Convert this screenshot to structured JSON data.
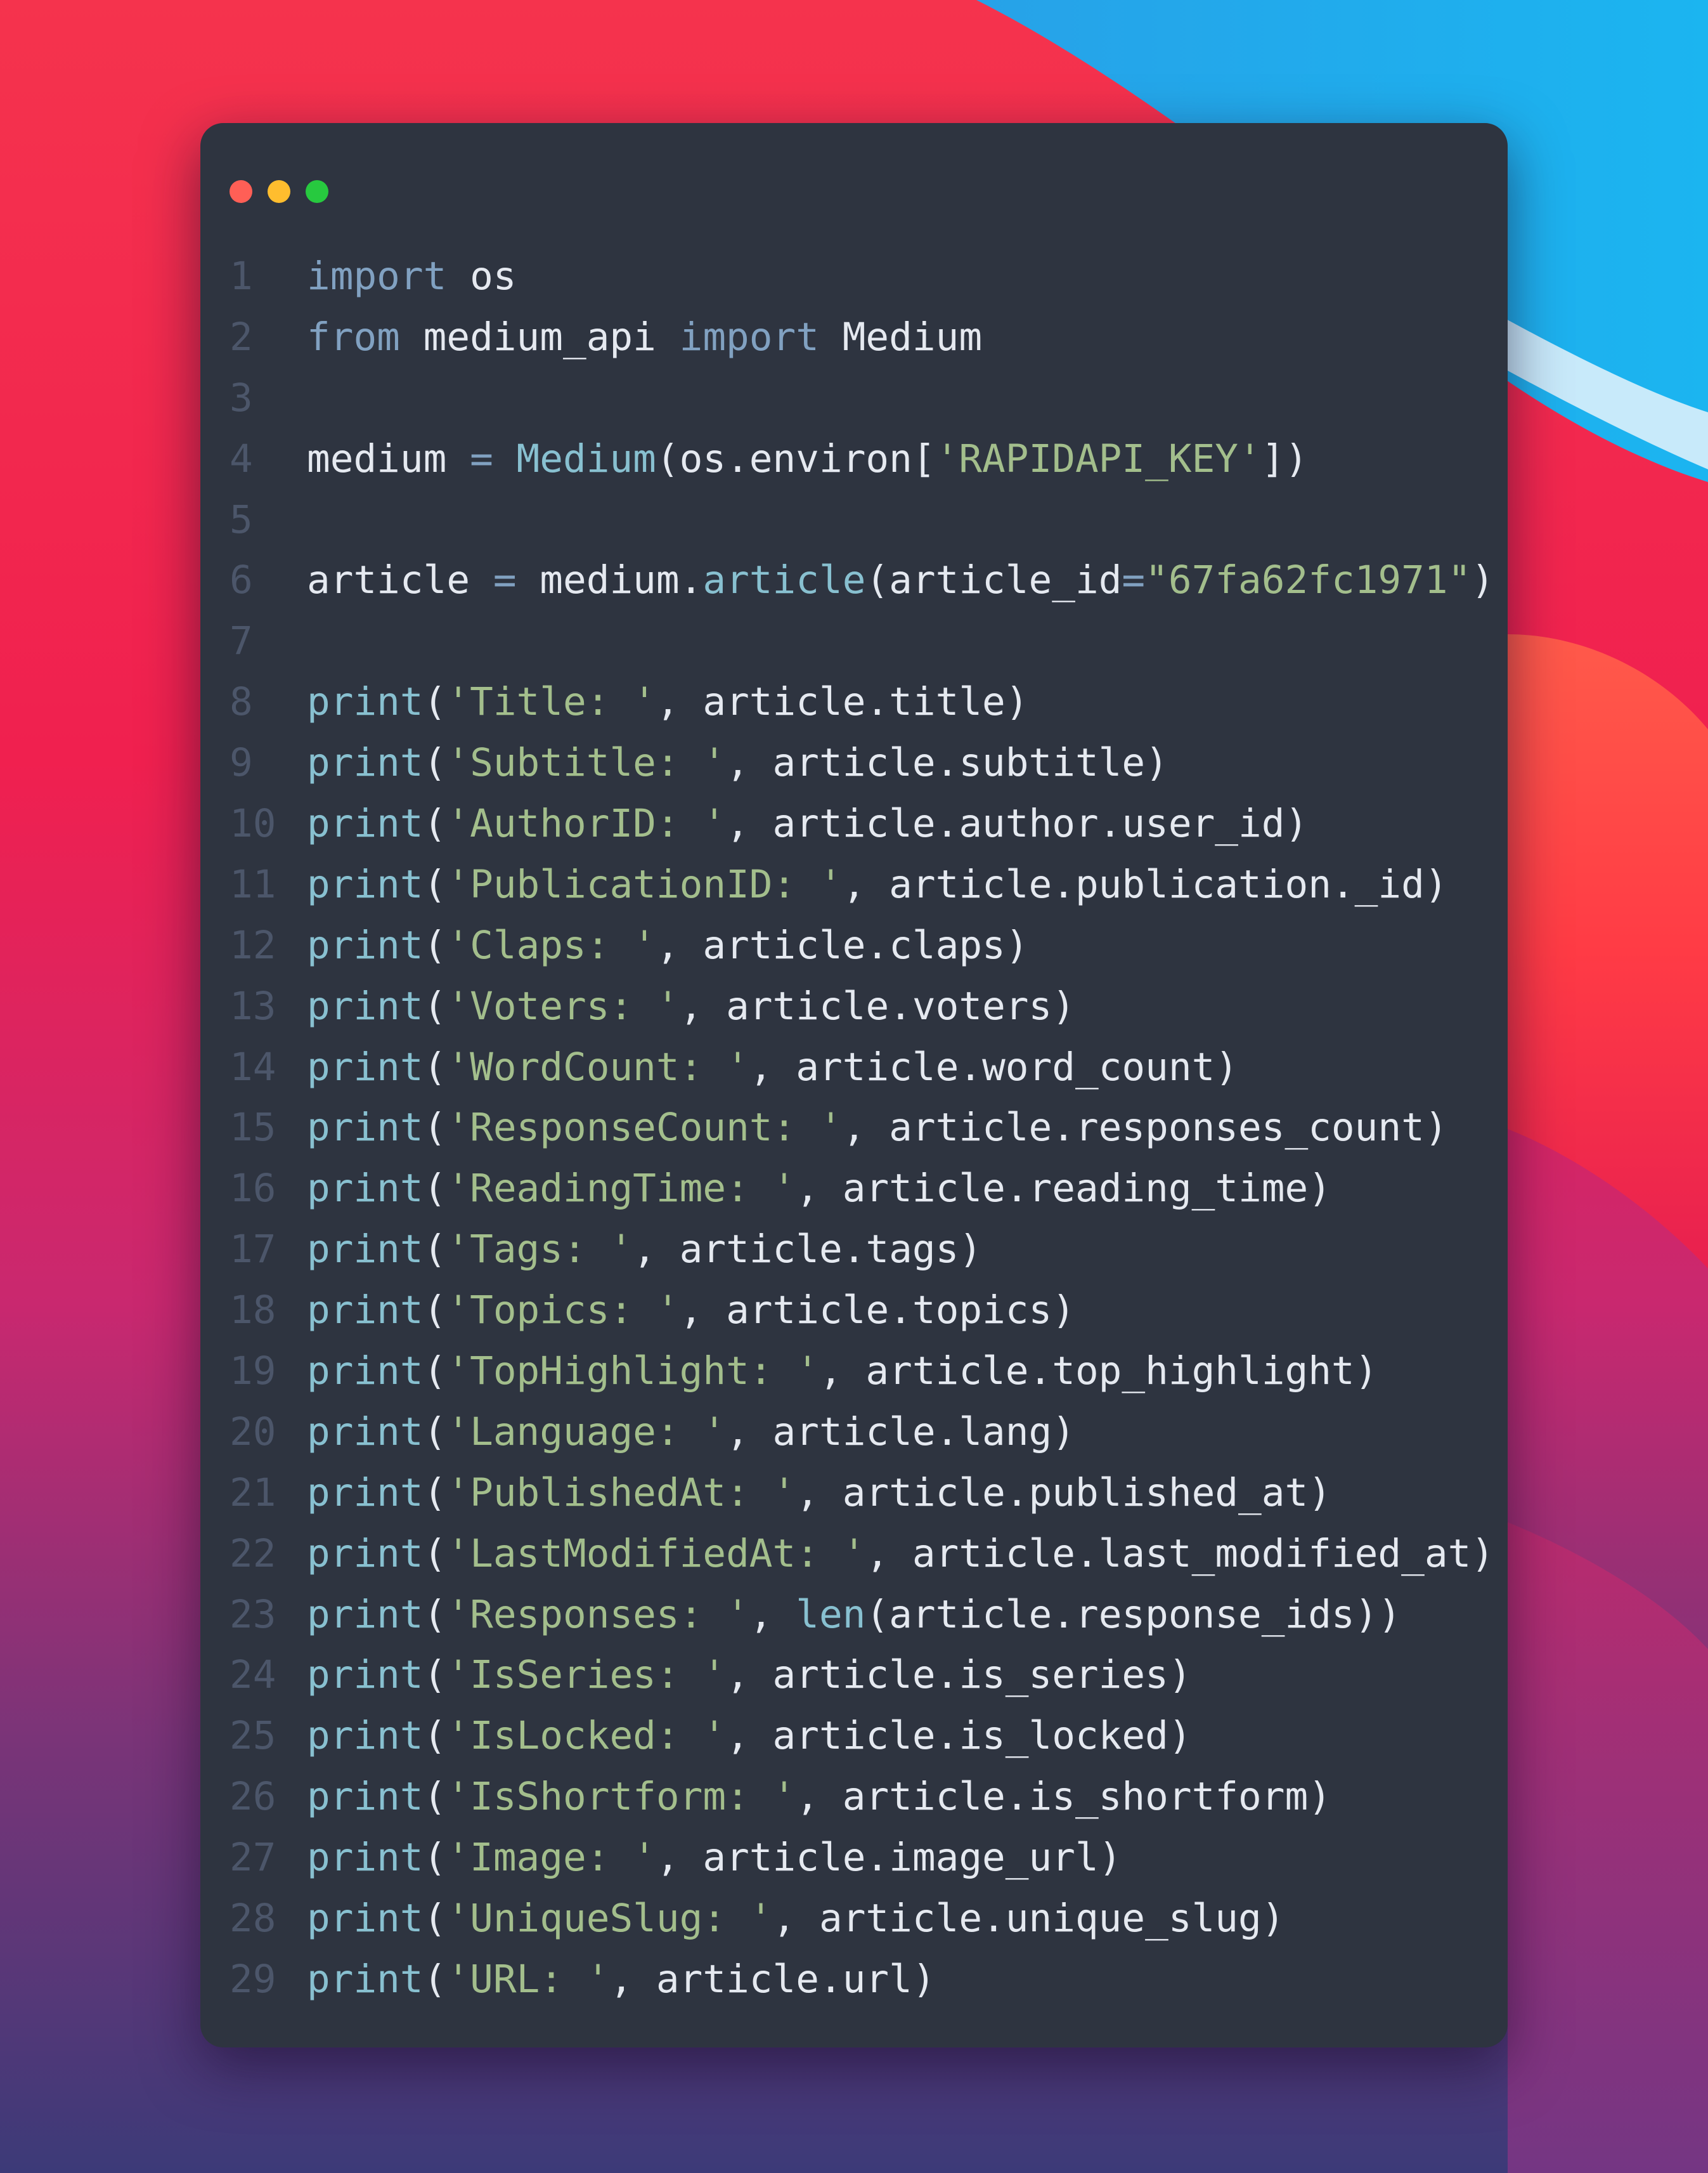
{
  "window": {
    "controls": [
      "close",
      "minimize",
      "zoom"
    ]
  },
  "theme": {
    "background": "#2e3440",
    "keyword": "#81a1c1",
    "function": "#88c0d0",
    "string": "#a3be8c",
    "text": "#e5e9f0",
    "line_number": "#4c566a",
    "close": "#ff5f56",
    "minimize": "#ffbd2e",
    "zoom": "#27c93f"
  },
  "code": {
    "language": "python",
    "lines": [
      {
        "number": "1",
        "tokens": [
          {
            "t": "kw",
            "v": "import"
          },
          {
            "t": "tx",
            "v": " os"
          }
        ]
      },
      {
        "number": "2",
        "tokens": [
          {
            "t": "kw",
            "v": "from"
          },
          {
            "t": "tx",
            "v": " medium_api "
          },
          {
            "t": "kw",
            "v": "import"
          },
          {
            "t": "tx",
            "v": " Medium"
          }
        ]
      },
      {
        "number": "3",
        "tokens": []
      },
      {
        "number": "4",
        "tokens": [
          {
            "t": "tx",
            "v": "medium "
          },
          {
            "t": "op",
            "v": "="
          },
          {
            "t": "tx",
            "v": " "
          },
          {
            "t": "fn",
            "v": "Medium"
          },
          {
            "t": "tx",
            "v": "(os.environ["
          },
          {
            "t": "str",
            "v": "'RAPIDAPI_KEY'"
          },
          {
            "t": "tx",
            "v": "])"
          }
        ]
      },
      {
        "number": "5",
        "tokens": []
      },
      {
        "number": "6",
        "tokens": [
          {
            "t": "tx",
            "v": "article "
          },
          {
            "t": "op",
            "v": "="
          },
          {
            "t": "tx",
            "v": " medium."
          },
          {
            "t": "fn",
            "v": "article"
          },
          {
            "t": "tx",
            "v": "(article_id"
          },
          {
            "t": "op",
            "v": "="
          },
          {
            "t": "str",
            "v": "\"67fa62fc1971\""
          },
          {
            "t": "tx",
            "v": ")"
          }
        ]
      },
      {
        "number": "7",
        "tokens": []
      },
      {
        "number": "8",
        "tokens": [
          {
            "t": "fn",
            "v": "print"
          },
          {
            "t": "tx",
            "v": "("
          },
          {
            "t": "str",
            "v": "'Title: '"
          },
          {
            "t": "tx",
            "v": ", article.title)"
          }
        ]
      },
      {
        "number": "9",
        "tokens": [
          {
            "t": "fn",
            "v": "print"
          },
          {
            "t": "tx",
            "v": "("
          },
          {
            "t": "str",
            "v": "'Subtitle: '"
          },
          {
            "t": "tx",
            "v": ", article.subtitle)"
          }
        ]
      },
      {
        "number": "10",
        "tokens": [
          {
            "t": "fn",
            "v": "print"
          },
          {
            "t": "tx",
            "v": "("
          },
          {
            "t": "str",
            "v": "'AuthorID: '"
          },
          {
            "t": "tx",
            "v": ", article.author.user_id)"
          }
        ]
      },
      {
        "number": "11",
        "tokens": [
          {
            "t": "fn",
            "v": "print"
          },
          {
            "t": "tx",
            "v": "("
          },
          {
            "t": "str",
            "v": "'PublicationID: '"
          },
          {
            "t": "tx",
            "v": ", article.publication._id)"
          }
        ]
      },
      {
        "number": "12",
        "tokens": [
          {
            "t": "fn",
            "v": "print"
          },
          {
            "t": "tx",
            "v": "("
          },
          {
            "t": "str",
            "v": "'Claps: '"
          },
          {
            "t": "tx",
            "v": ", article.claps)"
          }
        ]
      },
      {
        "number": "13",
        "tokens": [
          {
            "t": "fn",
            "v": "print"
          },
          {
            "t": "tx",
            "v": "("
          },
          {
            "t": "str",
            "v": "'Voters: '"
          },
          {
            "t": "tx",
            "v": ", article.voters)"
          }
        ]
      },
      {
        "number": "14",
        "tokens": [
          {
            "t": "fn",
            "v": "print"
          },
          {
            "t": "tx",
            "v": "("
          },
          {
            "t": "str",
            "v": "'WordCount: '"
          },
          {
            "t": "tx",
            "v": ", article.word_count)"
          }
        ]
      },
      {
        "number": "15",
        "tokens": [
          {
            "t": "fn",
            "v": "print"
          },
          {
            "t": "tx",
            "v": "("
          },
          {
            "t": "str",
            "v": "'ResponseCount: '"
          },
          {
            "t": "tx",
            "v": ", article.responses_count)"
          }
        ]
      },
      {
        "number": "16",
        "tokens": [
          {
            "t": "fn",
            "v": "print"
          },
          {
            "t": "tx",
            "v": "("
          },
          {
            "t": "str",
            "v": "'ReadingTime: '"
          },
          {
            "t": "tx",
            "v": ", article.reading_time)"
          }
        ]
      },
      {
        "number": "17",
        "tokens": [
          {
            "t": "fn",
            "v": "print"
          },
          {
            "t": "tx",
            "v": "("
          },
          {
            "t": "str",
            "v": "'Tags: '"
          },
          {
            "t": "tx",
            "v": ", article.tags)"
          }
        ]
      },
      {
        "number": "18",
        "tokens": [
          {
            "t": "fn",
            "v": "print"
          },
          {
            "t": "tx",
            "v": "("
          },
          {
            "t": "str",
            "v": "'Topics: '"
          },
          {
            "t": "tx",
            "v": ", article.topics)"
          }
        ]
      },
      {
        "number": "19",
        "tokens": [
          {
            "t": "fn",
            "v": "print"
          },
          {
            "t": "tx",
            "v": "("
          },
          {
            "t": "str",
            "v": "'TopHighlight: '"
          },
          {
            "t": "tx",
            "v": ", article.top_highlight)"
          }
        ]
      },
      {
        "number": "20",
        "tokens": [
          {
            "t": "fn",
            "v": "print"
          },
          {
            "t": "tx",
            "v": "("
          },
          {
            "t": "str",
            "v": "'Language: '"
          },
          {
            "t": "tx",
            "v": ", article.lang)"
          }
        ]
      },
      {
        "number": "21",
        "tokens": [
          {
            "t": "fn",
            "v": "print"
          },
          {
            "t": "tx",
            "v": "("
          },
          {
            "t": "str",
            "v": "'PublishedAt: '"
          },
          {
            "t": "tx",
            "v": ", article.published_at)"
          }
        ]
      },
      {
        "number": "22",
        "tokens": [
          {
            "t": "fn",
            "v": "print"
          },
          {
            "t": "tx",
            "v": "("
          },
          {
            "t": "str",
            "v": "'LastModifiedAt: '"
          },
          {
            "t": "tx",
            "v": ", article.last_modified_at)"
          }
        ]
      },
      {
        "number": "23",
        "tokens": [
          {
            "t": "fn",
            "v": "print"
          },
          {
            "t": "tx",
            "v": "("
          },
          {
            "t": "str",
            "v": "'Responses: '"
          },
          {
            "t": "tx",
            "v": ", "
          },
          {
            "t": "fn",
            "v": "len"
          },
          {
            "t": "tx",
            "v": "(article.response_ids))"
          }
        ]
      },
      {
        "number": "24",
        "tokens": [
          {
            "t": "fn",
            "v": "print"
          },
          {
            "t": "tx",
            "v": "("
          },
          {
            "t": "str",
            "v": "'IsSeries: '"
          },
          {
            "t": "tx",
            "v": ", article.is_series)"
          }
        ]
      },
      {
        "number": "25",
        "tokens": [
          {
            "t": "fn",
            "v": "print"
          },
          {
            "t": "tx",
            "v": "("
          },
          {
            "t": "str",
            "v": "'IsLocked: '"
          },
          {
            "t": "tx",
            "v": ", article.is_locked)"
          }
        ]
      },
      {
        "number": "26",
        "tokens": [
          {
            "t": "fn",
            "v": "print"
          },
          {
            "t": "tx",
            "v": "("
          },
          {
            "t": "str",
            "v": "'IsShortform: '"
          },
          {
            "t": "tx",
            "v": ", article.is_shortform)"
          }
        ]
      },
      {
        "number": "27",
        "tokens": [
          {
            "t": "fn",
            "v": "print"
          },
          {
            "t": "tx",
            "v": "("
          },
          {
            "t": "str",
            "v": "'Image: '"
          },
          {
            "t": "tx",
            "v": ", article.image_url)"
          }
        ]
      },
      {
        "number": "28",
        "tokens": [
          {
            "t": "fn",
            "v": "print"
          },
          {
            "t": "tx",
            "v": "("
          },
          {
            "t": "str",
            "v": "'UniqueSlug: '"
          },
          {
            "t": "tx",
            "v": ", article.unique_slug)"
          }
        ]
      },
      {
        "number": "29",
        "tokens": [
          {
            "t": "fn",
            "v": "print"
          },
          {
            "t": "tx",
            "v": "("
          },
          {
            "t": "str",
            "v": "'URL: '"
          },
          {
            "t": "tx",
            "v": ", article.url)"
          }
        ]
      }
    ]
  }
}
